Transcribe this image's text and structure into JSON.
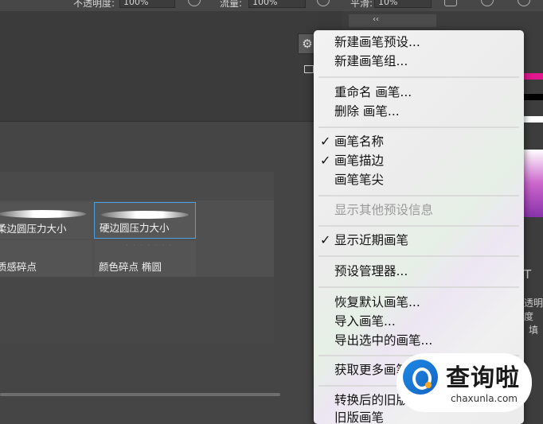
{
  "toolbar": {
    "opacity_label": "不透明度:",
    "opacity_value": "100%",
    "flow_label": "流量:",
    "flow_value": "100%",
    "smoothing_label": "平滑:",
    "smoothing_value": "10%"
  },
  "right_panel": {
    "collapse_glyph": "‹‹",
    "type_glyph": "T",
    "opacity_partial": "透明度",
    "fill_partial": "填"
  },
  "brush_panel": {
    "settings_glyph": "⚙",
    "brushes": [
      {
        "name": "柔边圆压力大小"
      },
      {
        "name": "硬边圆压力大小"
      },
      {
        "name": "质感碎点"
      },
      {
        "name": "颜色碎点 椭圆"
      }
    ]
  },
  "menu": {
    "items": [
      {
        "label": "新建画笔预设...",
        "checked": false,
        "enabled": true
      },
      {
        "label": "新建画笔组...",
        "checked": false,
        "enabled": true
      },
      {
        "label": "重命名 画笔...",
        "checked": false,
        "enabled": true
      },
      {
        "label": "删除 画笔...",
        "checked": false,
        "enabled": true
      },
      {
        "label": "画笔名称",
        "checked": true,
        "enabled": true
      },
      {
        "label": "画笔描边",
        "checked": true,
        "enabled": true
      },
      {
        "label": "画笔笔尖",
        "checked": false,
        "enabled": true
      },
      {
        "label": "显示其他预设信息",
        "checked": false,
        "enabled": false
      },
      {
        "label": "显示近期画笔",
        "checked": true,
        "enabled": true
      },
      {
        "label": "预设管理器...",
        "checked": false,
        "enabled": true
      },
      {
        "label": "恢复默认画笔...",
        "checked": false,
        "enabled": true
      },
      {
        "label": "导入画笔...",
        "checked": false,
        "enabled": true
      },
      {
        "label": "导出选中的画笔...",
        "checked": false,
        "enabled": true
      },
      {
        "label": "获取更多画笔...",
        "checked": false,
        "enabled": true
      },
      {
        "label": "转换后的旧版工具预设",
        "checked": false,
        "enabled": true
      },
      {
        "label": "旧版画笔",
        "checked": false,
        "enabled": true
      }
    ],
    "check_glyph": "✓"
  },
  "watermark": {
    "cn": "查询啦",
    "en": "chaxunla.com"
  },
  "colors": {
    "selection_border": "#4aa3e6",
    "magenta": "#e0188c",
    "menu_bg": "#efefef"
  }
}
